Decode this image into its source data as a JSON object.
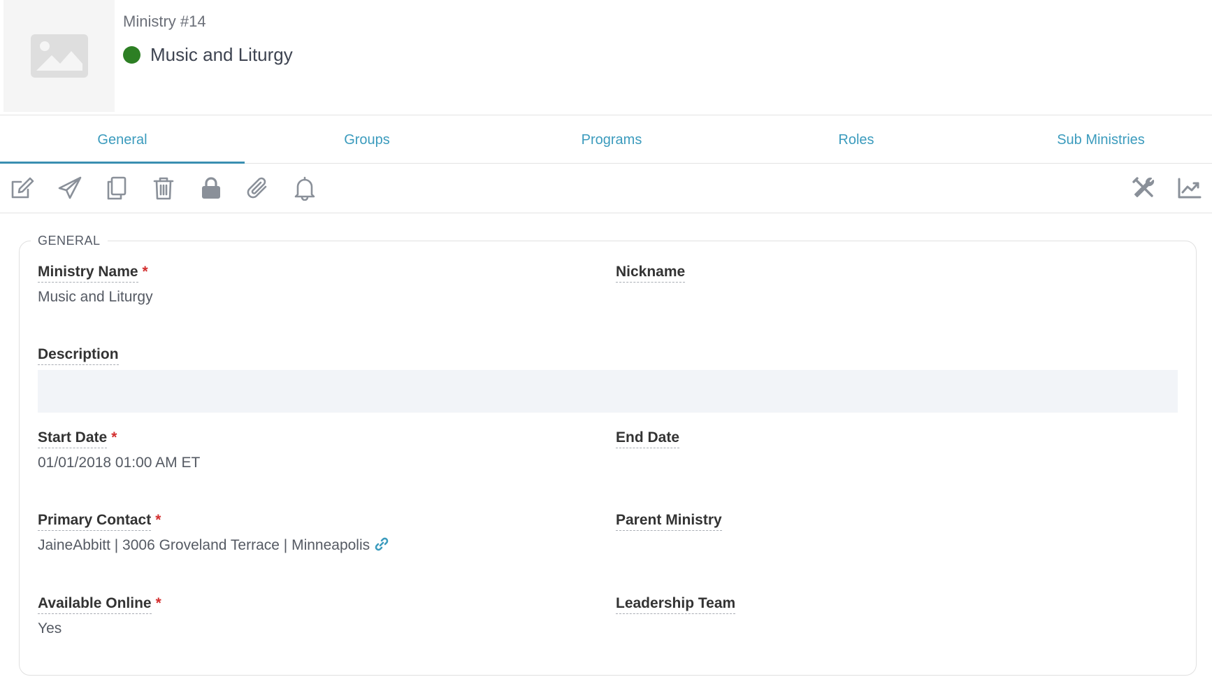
{
  "header": {
    "record_number": "Ministry #14",
    "title": "Music and Liturgy",
    "status_color": "#2d7f24",
    "thumbnail_icon": "image-placeholder-icon"
  },
  "tabs": [
    {
      "label": "General",
      "active": true
    },
    {
      "label": "Groups",
      "active": false
    },
    {
      "label": "Programs",
      "active": false
    },
    {
      "label": "Roles",
      "active": false
    },
    {
      "label": "Sub Ministries",
      "active": false
    }
  ],
  "toolbar": {
    "left_icons": [
      "edit-icon",
      "send-icon",
      "copy-icon",
      "trash-icon",
      "lock-icon",
      "paperclip-icon",
      "bell-icon"
    ],
    "right_icons": [
      "tools-icon",
      "chart-icon"
    ]
  },
  "general": {
    "legend": "GENERAL",
    "ministry_name_label": "Ministry Name",
    "ministry_name_value": "Music and Liturgy",
    "nickname_label": "Nickname",
    "nickname_value": "",
    "description_label": "Description",
    "description_value": "",
    "start_date_label": "Start Date",
    "start_date_value": "01/01/2018 01:00 AM ET",
    "end_date_label": "End Date",
    "end_date_value": "",
    "primary_contact_label": "Primary Contact",
    "primary_contact_value": "JaineAbbitt | 3006 Groveland Terrace | Minneapolis",
    "parent_ministry_label": "Parent Ministry",
    "parent_ministry_value": "",
    "available_online_label": "Available Online",
    "available_online_value": "Yes",
    "leadership_team_label": "Leadership Team",
    "leadership_team_value": "",
    "required_marker": "*"
  },
  "colors": {
    "accent": "#3b9bbd",
    "required": "#d32f2f",
    "icon": "#8a9099"
  }
}
